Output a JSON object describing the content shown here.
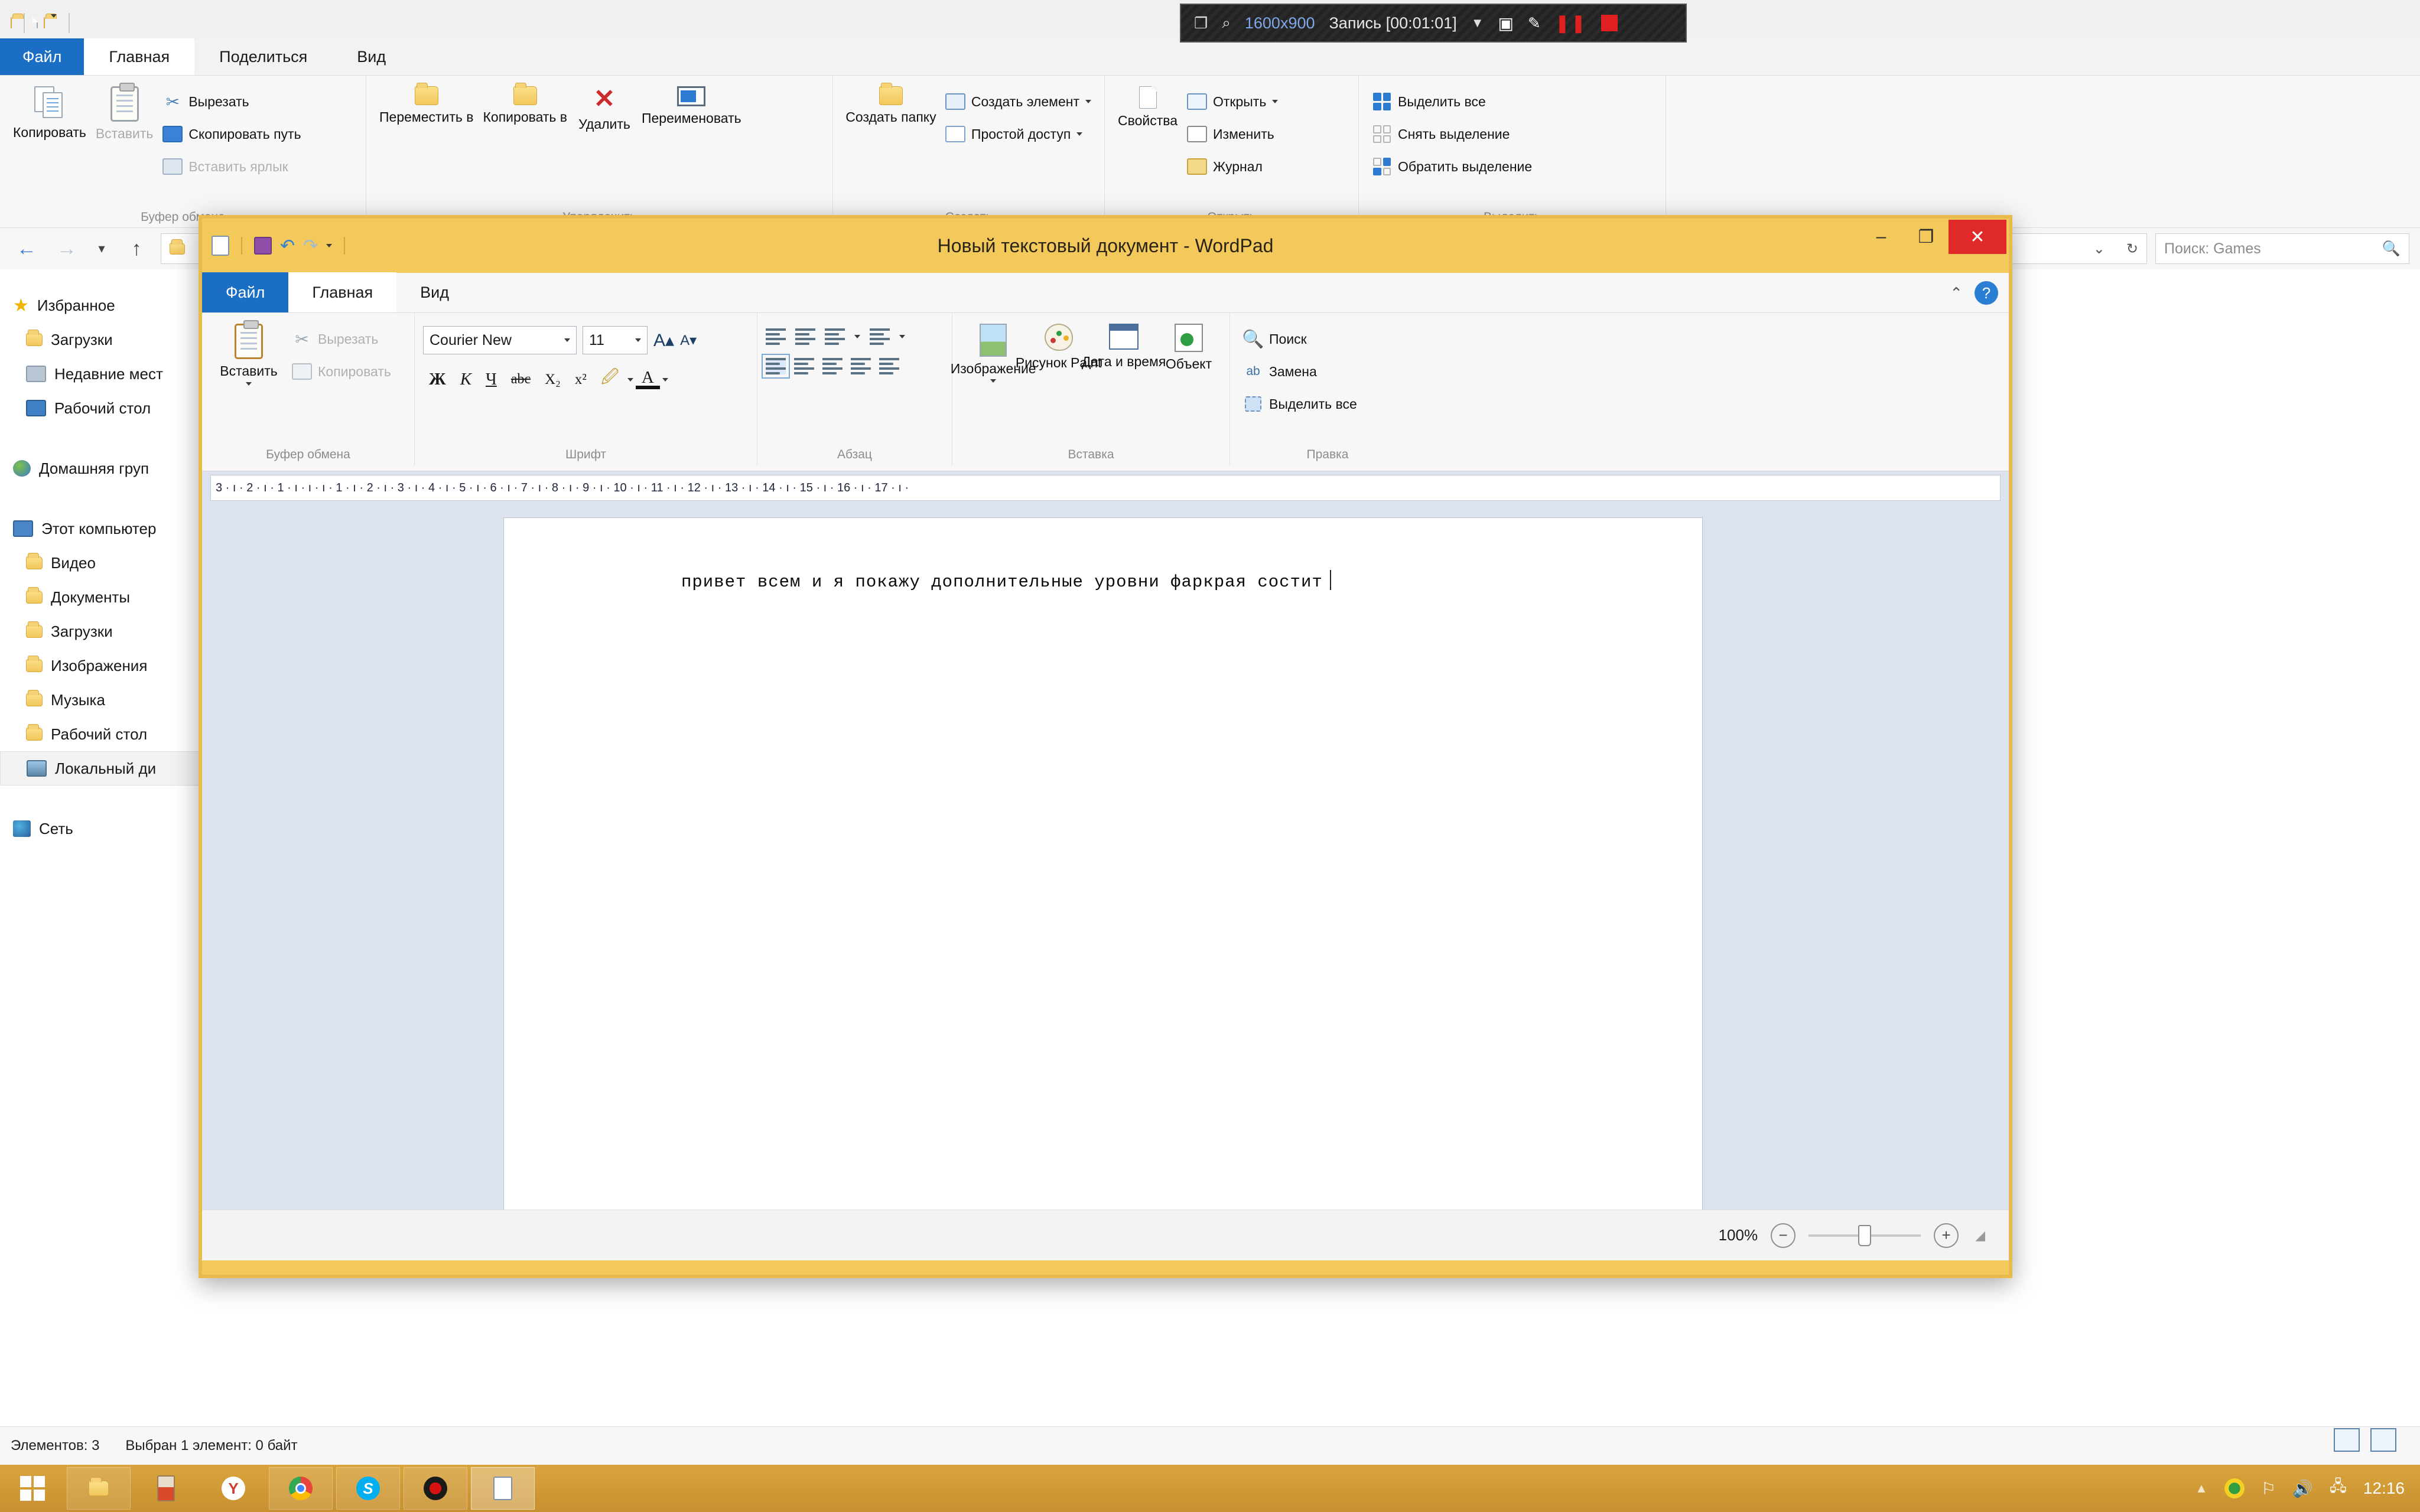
{
  "recorder": {
    "resolution": "1600x900",
    "status": "Запись [00:01:01]",
    "icons": [
      "window-icon",
      "magnifier-icon",
      "chevron-down-icon",
      "camera-icon",
      "pencil-icon",
      "pause-icon",
      "stop-icon"
    ]
  },
  "explorer": {
    "quick_access": [
      "folder-icon",
      "new-folder-shortcut-icon",
      "folder-icon",
      "chevron-down-icon"
    ],
    "tabs": [
      {
        "label": "Файл",
        "active": false,
        "kind": "file"
      },
      {
        "label": "Главная",
        "active": true,
        "kind": "normal"
      },
      {
        "label": "Поделиться",
        "active": false,
        "kind": "normal"
      },
      {
        "label": "Вид",
        "active": false,
        "kind": "normal"
      }
    ],
    "ribbon_groups": [
      {
        "name": "Буфер обмена",
        "big": [
          {
            "label": "Копировать",
            "icon": "copy-icon",
            "disabled": false
          },
          {
            "label": "Вставить",
            "icon": "paste-clipboard-icon",
            "disabled": true
          }
        ],
        "small": [
          {
            "label": "Вырезать",
            "icon": "scissors-icon",
            "disabled": false
          },
          {
            "label": "Скопировать путь",
            "icon": "copy-path-icon",
            "disabled": false
          },
          {
            "label": "Вставить ярлык",
            "icon": "paste-shortcut-icon",
            "disabled": true
          }
        ]
      },
      {
        "name": "Упорядочить",
        "big": [
          {
            "label": "Переместить в",
            "icon": "move-to-icon",
            "disabled": false,
            "dropdown": true
          },
          {
            "label": "Копировать в",
            "icon": "copy-to-icon",
            "disabled": false,
            "dropdown": true
          },
          {
            "label": "Удалить",
            "icon": "delete-x-icon",
            "disabled": false,
            "dropdown": true
          },
          {
            "label": "Переименовать",
            "icon": "rename-icon",
            "disabled": false
          }
        ],
        "small": []
      },
      {
        "name": "Создать",
        "big": [
          {
            "label": "Создать папку",
            "icon": "new-folder-icon",
            "disabled": false
          }
        ],
        "small": [
          {
            "label": "Создать элемент",
            "icon": "new-item-icon",
            "disabled": false,
            "dropdown": true
          },
          {
            "label": "Простой доступ",
            "icon": "easy-access-icon",
            "disabled": false,
            "dropdown": true
          }
        ]
      },
      {
        "name": "Открыть",
        "big": [
          {
            "label": "Свойства",
            "icon": "properties-icon",
            "disabled": false,
            "dropdown": true
          }
        ],
        "small": [
          {
            "label": "Открыть",
            "icon": "open-with-icon",
            "disabled": false,
            "dropdown": true
          },
          {
            "label": "Изменить",
            "icon": "edit-pencil-icon",
            "disabled": false
          },
          {
            "label": "Журнал",
            "icon": "history-icon",
            "disabled": false
          }
        ]
      },
      {
        "name": "Выделить",
        "big": [],
        "small": [
          {
            "label": "Выделить все",
            "icon": "select-all-icon",
            "disabled": false
          },
          {
            "label": "Снять выделение",
            "icon": "select-none-icon",
            "disabled": false
          },
          {
            "label": "Обратить выделение",
            "icon": "invert-selection-icon",
            "disabled": false
          }
        ]
      }
    ],
    "address": {
      "back_icon": "back-arrow-icon",
      "forward_icon": "forward-arrow-icon",
      "recent_icon": "chevron-down-icon",
      "up_icon": "up-arrow-icon",
      "path_dropdown_icon": "chevron-down-icon",
      "refresh_icon": "refresh-icon",
      "search_placeholder": "Поиск: Games",
      "search_icon": "search-icon"
    },
    "nav_pane": [
      {
        "label": "Избранное",
        "icon": "star-icon",
        "level": 0
      },
      {
        "label": "Загрузки",
        "icon": "downloads-folder-icon",
        "level": 1
      },
      {
        "label": "Недавние мест",
        "icon": "recent-places-icon",
        "level": 1
      },
      {
        "label": "Рабочий стол",
        "icon": "desktop-icon",
        "level": 1
      },
      {
        "label": "Домашняя груп",
        "icon": "homegroup-icon",
        "level": 0,
        "gap_before": true
      },
      {
        "label": "Этот компьютер",
        "icon": "this-pc-icon",
        "level": 0,
        "gap_before": true
      },
      {
        "label": "Видео",
        "icon": "videos-folder-icon",
        "level": 1
      },
      {
        "label": "Документы",
        "icon": "documents-folder-icon",
        "level": 1
      },
      {
        "label": "Загрузки",
        "icon": "downloads-folder-icon",
        "level": 1
      },
      {
        "label": "Изображения",
        "icon": "pictures-folder-icon",
        "level": 1
      },
      {
        "label": "Музыка",
        "icon": "music-folder-icon",
        "level": 1
      },
      {
        "label": "Рабочий стол",
        "icon": "desktop-folder-icon",
        "level": 1
      },
      {
        "label": "Локальный ди",
        "icon": "local-disk-icon",
        "level": 1,
        "selected": true
      },
      {
        "label": "Сеть",
        "icon": "network-icon",
        "level": 0,
        "gap_before": true
      }
    ],
    "status": {
      "items_count": "Элементов: 3",
      "selection": "Выбран 1 элемент: 0 байт",
      "view_details_icon": "details-view-icon",
      "view_tiles_icon": "tiles-view-icon"
    }
  },
  "wordpad": {
    "title": "Новый текстовый документ - WordPad",
    "quick_access": [
      "wordpad-icon",
      "save-icon",
      "undo-icon",
      "redo-icon",
      "chevron-down-icon"
    ],
    "window_buttons": {
      "minimize": "–",
      "maximize": "❐",
      "close": "✕"
    },
    "help": {
      "collapse_icon": "chevron-up-icon",
      "help_icon": "question-mark-icon"
    },
    "tabs": [
      {
        "label": "Файл",
        "active": false,
        "kind": "file"
      },
      {
        "label": "Главная",
        "active": true,
        "kind": "normal"
      },
      {
        "label": "Вид",
        "active": false,
        "kind": "normal"
      }
    ],
    "groups": {
      "clipboard": {
        "name": "Буфер обмена",
        "paste_label": "Вставить",
        "paste_icon": "paste-clipboard-icon",
        "cut_label": "Вырезать",
        "cut_icon": "scissors-icon",
        "copy_label": "Копировать",
        "copy_icon": "copy-icon"
      },
      "font": {
        "name": "Шрифт",
        "family": "Courier New",
        "size": "11",
        "grow_icon": "grow-font-icon",
        "shrink_icon": "shrink-font-icon",
        "bold": "Ж",
        "italic": "К",
        "underline": "Ч",
        "strike": "abc",
        "subscript": "X₂",
        "superscript": "x²",
        "highlight_icon": "text-highlight-icon",
        "color_icon": "font-color-icon"
      },
      "paragraph": {
        "name": "Абзац",
        "decrease_indent_icon": "decrease-indent-icon",
        "increase_indent_icon": "increase-indent-icon",
        "bullets_icon": "bullets-icon",
        "line_spacing_icon": "line-spacing-icon",
        "align_left_icon": "align-left-icon",
        "align_center_icon": "align-center-icon",
        "align_right_icon": "align-right-icon",
        "justify_icon": "justify-icon",
        "paragraph_settings_icon": "paragraph-settings-icon"
      },
      "insert": {
        "name": "Вставка",
        "items": [
          {
            "label": "Изображение",
            "icon": "picture-icon",
            "dropdown": true
          },
          {
            "label": "Рисунок Paint",
            "icon": "paint-drawing-icon"
          },
          {
            "label": "Дата и время",
            "icon": "date-time-icon"
          },
          {
            "label": "Объект",
            "icon": "object-icon"
          }
        ]
      },
      "editing": {
        "name": "Правка",
        "items": [
          {
            "label": "Поиск",
            "icon": "binoculars-icon"
          },
          {
            "label": "Замена",
            "icon": "replace-icon"
          },
          {
            "label": "Выделить все",
            "icon": "select-all-icon"
          }
        ]
      }
    },
    "ruler": "3 · ı · 2 · ı · 1 · ı · ı   · ı · 1 · ı · 2 · ı · 3 · ı · 4 · ı · 5 · ı · 6 · ı · 7 · ı · 8 · ı · 9 · ı · 10 · ı · 11 · ı · 12 · ı · 13 · ı · 14 · ı · 15 · ı · 16 · ı · 17 · ı ·",
    "document_text": "привет всем и я покажу дополнительные уровни фаркрая состит",
    "status": {
      "zoom_level": "100%",
      "zoom_out_icon": "zoom-out-icon",
      "zoom_in_icon": "zoom-in-icon",
      "resize_grip_icon": "resize-grip-icon"
    }
  },
  "taskbar": {
    "start_icon": "windows-start-icon",
    "items": [
      {
        "icon": "file-explorer-icon",
        "active": false
      },
      {
        "icon": "unknown-red-app-icon",
        "active": false
      },
      {
        "icon": "yandex-browser-icon",
        "active": false
      },
      {
        "icon": "chrome-icon",
        "active": false
      },
      {
        "icon": "skype-icon",
        "active": false
      },
      {
        "icon": "recorder-icon",
        "active": false
      },
      {
        "icon": "wordpad-icon",
        "active": true
      }
    ],
    "tray": {
      "show_hidden_icon": "show-hidden-icons-icon",
      "antivirus_icon": "antivirus-shield-icon",
      "flag_icon": "action-center-flag-icon",
      "volume_icon": "volume-icon",
      "network_icon": "network-monitor-icon",
      "clock": "12:16"
    }
  },
  "colors": {
    "explorer_tab_accent": "#1a6fc4",
    "wordpad_chrome": "#f4c95b",
    "taskbar": "#d9a43e",
    "close_button": "#e02a2a",
    "recorder_red": "#e02020"
  }
}
